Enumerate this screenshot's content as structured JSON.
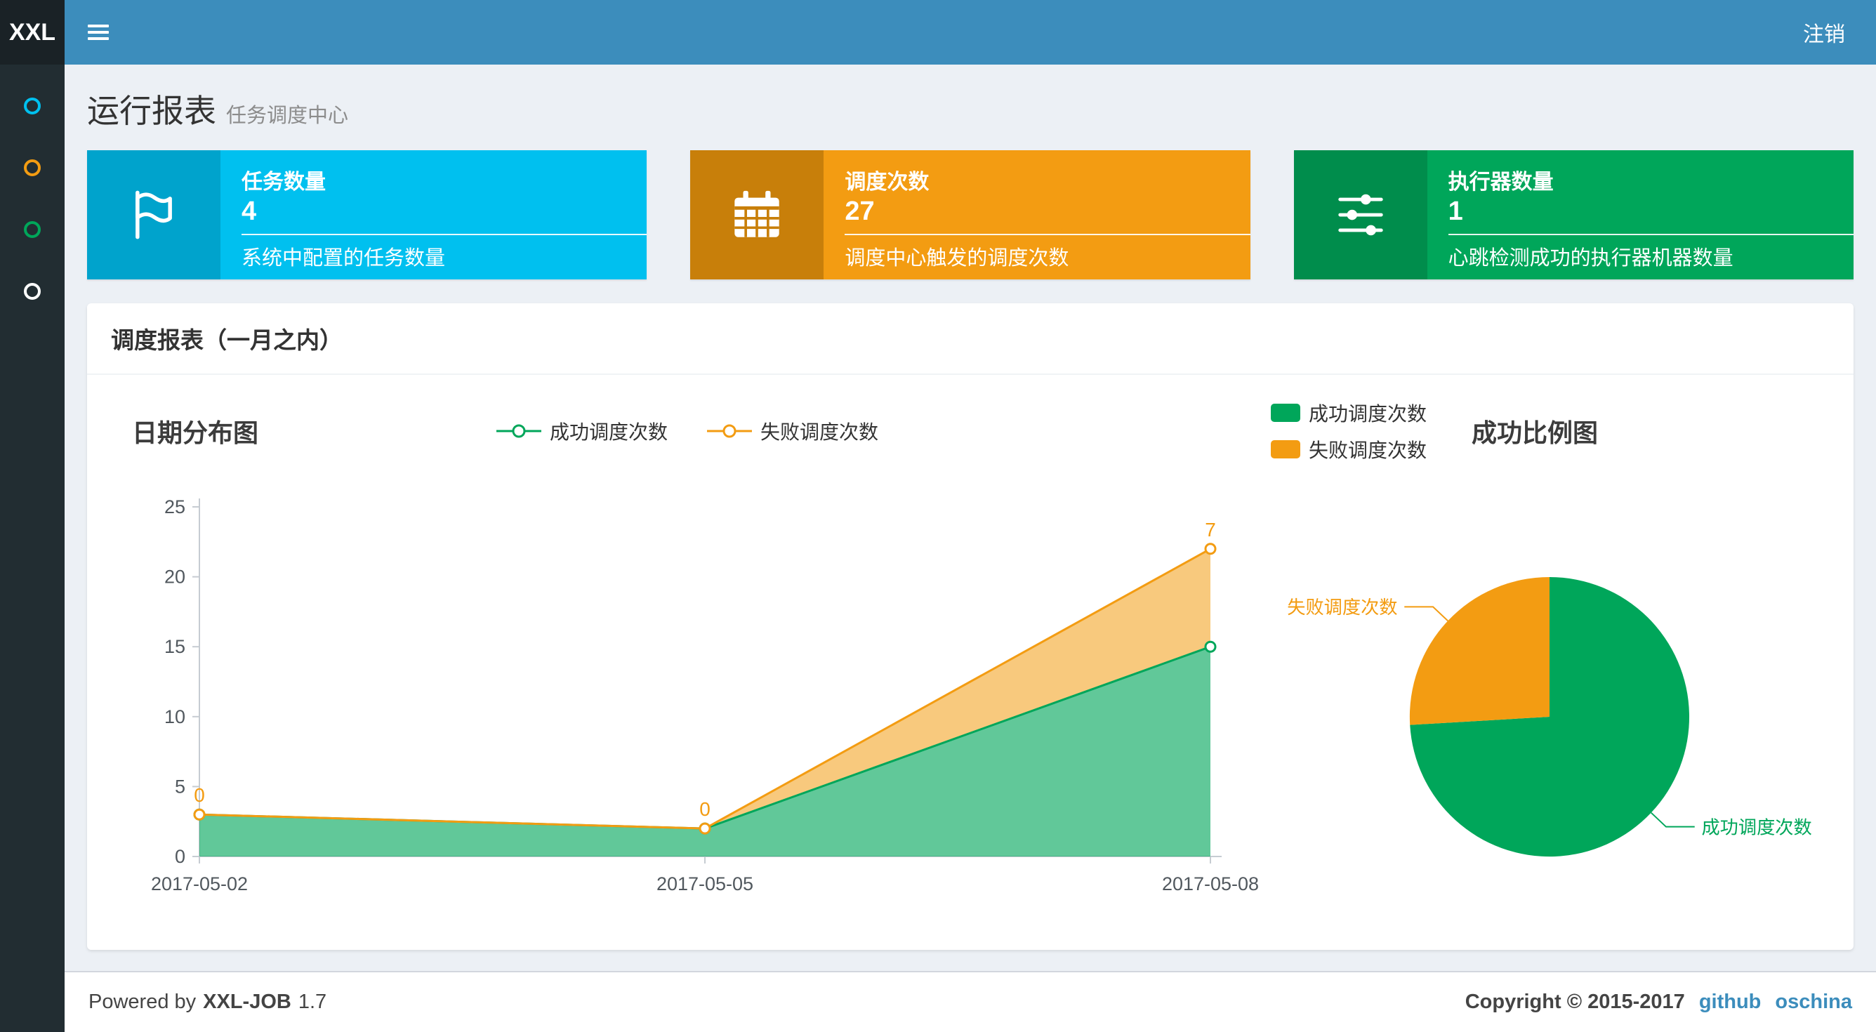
{
  "navbar": {
    "logo_text": "XXL",
    "logout_label": "注销"
  },
  "sidebar": {
    "items": [
      {
        "name": "menu-item-1",
        "color": "#00c0ef"
      },
      {
        "name": "menu-item-2",
        "color": "#f39c12"
      },
      {
        "name": "menu-item-3",
        "color": "#00a65a"
      },
      {
        "name": "menu-item-4",
        "color": "#ffffff"
      }
    ]
  },
  "page_header": {
    "title": "运行报表",
    "subtitle": "任务调度中心"
  },
  "info_boxes": [
    {
      "icon": "flag-icon",
      "title": "任务数量",
      "value": "4",
      "desc": "系统中配置的任务数量",
      "bg": "#00c0ef",
      "icon_bg": "#00a3cc"
    },
    {
      "icon": "calendar-icon",
      "title": "调度次数",
      "value": "27",
      "desc": "调度中心触发的调度次数",
      "bg": "#f39c12",
      "icon_bg": "#c87f0a"
    },
    {
      "icon": "sliders-icon",
      "title": "执行器数量",
      "value": "1",
      "desc": "心跳检测成功的执行器机器数量",
      "bg": "#00a65a",
      "icon_bg": "#008d4c"
    }
  ],
  "report_panel": {
    "title": "调度报表（一月之内）"
  },
  "chart_data": [
    {
      "type": "area",
      "title": "日期分布图",
      "x": [
        "2017-05-02",
        "2017-05-05",
        "2017-05-08"
      ],
      "series": [
        {
          "name": "成功调度次数",
          "color": "#00a65a",
          "values": [
            3,
            2,
            15
          ]
        },
        {
          "name": "失败调度次数",
          "color": "#f39c12",
          "values": [
            0,
            0,
            7
          ],
          "point_labels": [
            "0",
            "0",
            "7"
          ]
        }
      ],
      "stacked": true,
      "ylim": [
        0,
        25
      ],
      "yticks": [
        0,
        5,
        10,
        15,
        20,
        25
      ],
      "legend_position": "top-center",
      "grid": false
    },
    {
      "type": "pie",
      "title": "成功比例图",
      "legend_position": "top-left",
      "slices": [
        {
          "name": "成功调度次数",
          "value": 20,
          "color": "#00a65a"
        },
        {
          "name": "失败调度次数",
          "value": 7,
          "color": "#f39c12"
        }
      ],
      "start_angle": "top",
      "direction": "clockwise"
    }
  ],
  "footer": {
    "powered_by": "Powered by",
    "product": "XXL-JOB",
    "version": "1.7",
    "copyright": "Copyright © 2015-2017",
    "link_github": "github",
    "link_oschina": "oschina"
  }
}
